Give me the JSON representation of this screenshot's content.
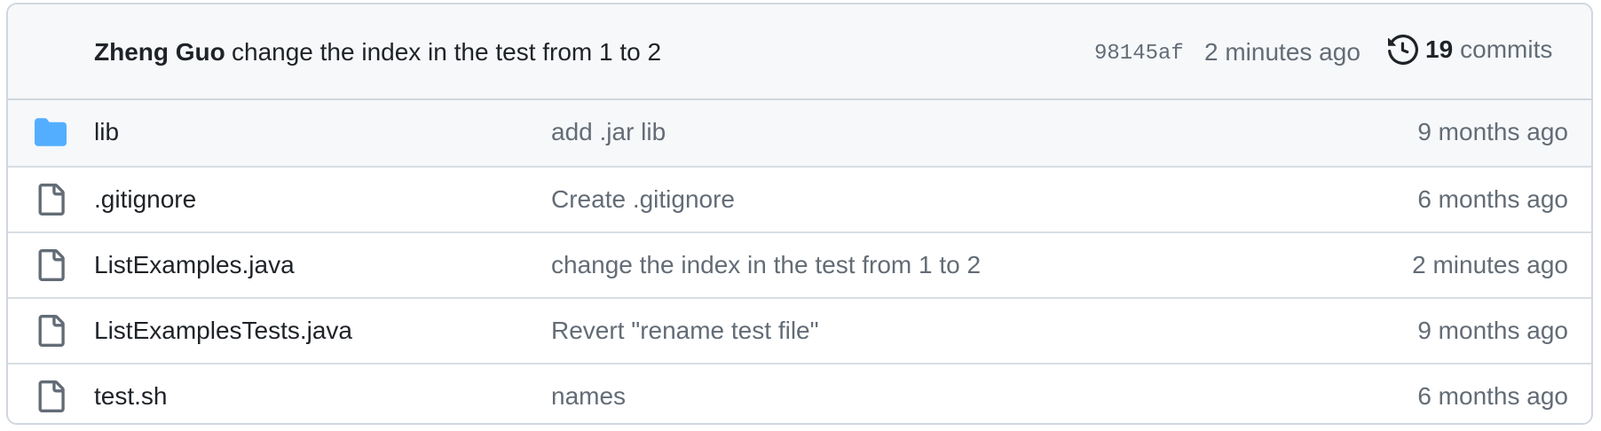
{
  "latest_commit": {
    "author": "Zheng Guo",
    "message": "change the index in the test from 1 to 2",
    "sha": "98145af",
    "age": "2 minutes ago",
    "commits_count": "19",
    "commits_label": "commits"
  },
  "files": [
    {
      "type": "folder",
      "icon": "folder-icon",
      "name": "lib",
      "commit_message": "add .jar lib",
      "time": "9 months ago"
    },
    {
      "type": "file",
      "icon": "file-icon",
      "name": ".gitignore",
      "commit_message": "Create .gitignore",
      "time": "6 months ago"
    },
    {
      "type": "file",
      "icon": "file-icon",
      "name": "ListExamples.java",
      "commit_message": "change the index in the test from 1 to 2",
      "time": "2 minutes ago"
    },
    {
      "type": "file",
      "icon": "file-icon",
      "name": "ListExamplesTests.java",
      "commit_message": "Revert \"rename test file\"",
      "time": "9 months ago"
    },
    {
      "type": "file",
      "icon": "file-icon",
      "name": "test.sh",
      "commit_message": "names",
      "time": "6 months ago"
    }
  ],
  "colors": {
    "folder": "#54aeff",
    "file_icon": "#636c76",
    "header_bg": "#f6f8fa",
    "border": "#d0d7de",
    "muted_text": "#636c76"
  }
}
